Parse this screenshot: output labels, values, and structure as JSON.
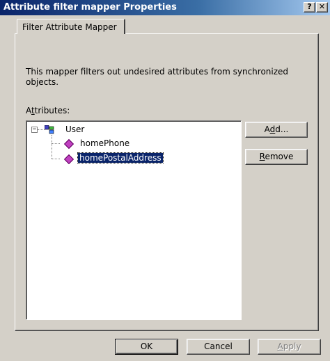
{
  "window": {
    "title": "Attribute filter mapper Properties",
    "help_glyph": "?",
    "close_glyph": "✕"
  },
  "tabs": [
    {
      "label": "Filter Attribute Mapper",
      "active": true
    }
  ],
  "panel": {
    "description": "This mapper filters out undesired attributes from synchronized objects.",
    "attributes_label_pre": "A",
    "attributes_label_u": "t",
    "attributes_label_post": "tributes:"
  },
  "tree": {
    "expander_glyph": "−",
    "root": {
      "label": "User",
      "icon": "class-icon",
      "expanded": true
    },
    "children": [
      {
        "label": "homePhone",
        "icon": "attribute-diamond-icon",
        "selected": false
      },
      {
        "label": "homePostalAddress",
        "icon": "attribute-diamond-icon",
        "selected": true
      }
    ]
  },
  "side_buttons": {
    "add_pre": "A",
    "add_u": "d",
    "add_post": "d...",
    "remove_u": "R",
    "remove_post": "emove"
  },
  "footer": {
    "ok_label": "OK",
    "cancel_label": "Cancel",
    "apply_u": "A",
    "apply_post": "pply",
    "apply_enabled": false
  },
  "colors": {
    "titlebar_start": "#0a246a",
    "titlebar_end": "#a6caf0",
    "face": "#d4d0c8",
    "selection": "#0a246a",
    "attribute_icon": "#c040c0"
  }
}
